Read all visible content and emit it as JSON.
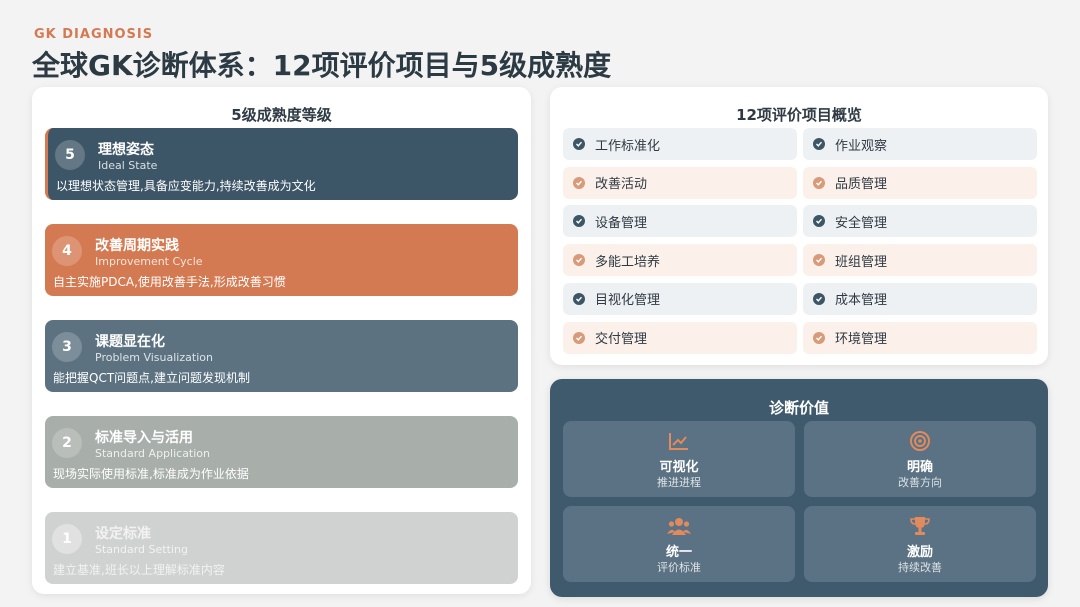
{
  "header": {
    "kicker": "GK DIAGNOSIS",
    "title": "全球GK诊断体系：12项评价项目与5级成熟度"
  },
  "maturity": {
    "title": "5级成熟度等级",
    "levels": [
      {
        "num": "5",
        "name": "理想姿态",
        "sub": "Ideal State",
        "desc": "以理想状态管理,具备应变能力,持续改善成为文化"
      },
      {
        "num": "4",
        "name": "改善周期实践",
        "sub": "Improvement Cycle",
        "desc": "自主实施PDCA,使用改善手法,形成改善习惯"
      },
      {
        "num": "3",
        "name": "课题显在化",
        "sub": "Problem Visualization",
        "desc": "能把握QCT问题点,建立问题发现机制"
      },
      {
        "num": "2",
        "name": "标准导入与活用",
        "sub": "Standard Application",
        "desc": "现场实际使用标准,标准成为作业依据"
      },
      {
        "num": "1",
        "name": "设定标准",
        "sub": "Standard Setting",
        "desc": "建立基准,班长以上理解标准内容"
      }
    ]
  },
  "items": {
    "title": "12项评价项目概览",
    "list": [
      {
        "label": "工作标准化",
        "tone": "blue"
      },
      {
        "label": "作业观察",
        "tone": "blue"
      },
      {
        "label": "改善活动",
        "tone": "orange"
      },
      {
        "label": "品质管理",
        "tone": "orange"
      },
      {
        "label": "设备管理",
        "tone": "blue"
      },
      {
        "label": "安全管理",
        "tone": "blue"
      },
      {
        "label": "多能工培养",
        "tone": "orange"
      },
      {
        "label": "班组管理",
        "tone": "orange"
      },
      {
        "label": "目视化管理",
        "tone": "blue"
      },
      {
        "label": "成本管理",
        "tone": "blue"
      },
      {
        "label": "交付管理",
        "tone": "orange"
      },
      {
        "label": "环境管理",
        "tone": "orange"
      }
    ]
  },
  "value": {
    "title": "诊断价值",
    "cards": [
      {
        "name": "可视化",
        "sub": "推进进程",
        "icon": "chart-line-icon"
      },
      {
        "name": "明确",
        "sub": "改善方向",
        "icon": "target-icon"
      },
      {
        "name": "统一",
        "sub": "评价标准",
        "icon": "users-icon"
      },
      {
        "name": "激励",
        "sub": "持续改善",
        "icon": "trophy-icon"
      }
    ]
  },
  "colors": {
    "navy": "#3d5667",
    "orange": "#d47a52",
    "slate": "#5c7281"
  }
}
